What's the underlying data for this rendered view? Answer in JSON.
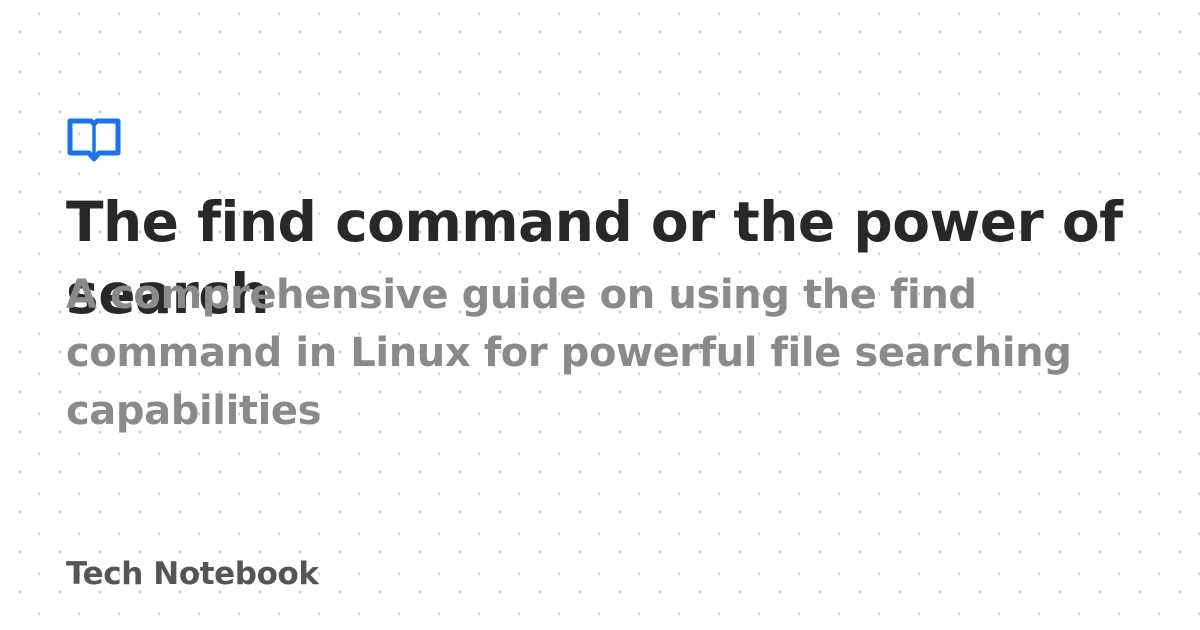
{
  "card": {
    "title": "The find command or the power of search",
    "subtitle": "A comprehensive guide on using the find command in Linux for powerful file searching capabilities",
    "brand": "Tech Notebook"
  },
  "logo": {
    "icon": "open-book-icon",
    "color": "#1a73e8"
  },
  "colors": {
    "background": "#ffffff",
    "title": "#282828",
    "subtitle": "#8a8a8a",
    "brand": "#555555",
    "pattern": "#d6d6d6"
  }
}
